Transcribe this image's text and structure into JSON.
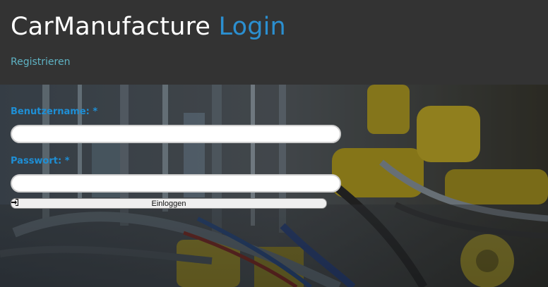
{
  "header": {
    "title_main": "CarManufacture",
    "title_accent": "Login",
    "register_link": "Registrieren"
  },
  "form": {
    "username_label": "Benutzername: *",
    "username_value": "",
    "password_label": "Passwort: *",
    "password_value": "",
    "login_button": "Einloggen",
    "login_icon": "sign-in-icon"
  },
  "colors": {
    "header_bg": "#333333",
    "accent": "#2b8fd0",
    "label": "#1e8fd6",
    "link": "#5fb3c4"
  }
}
